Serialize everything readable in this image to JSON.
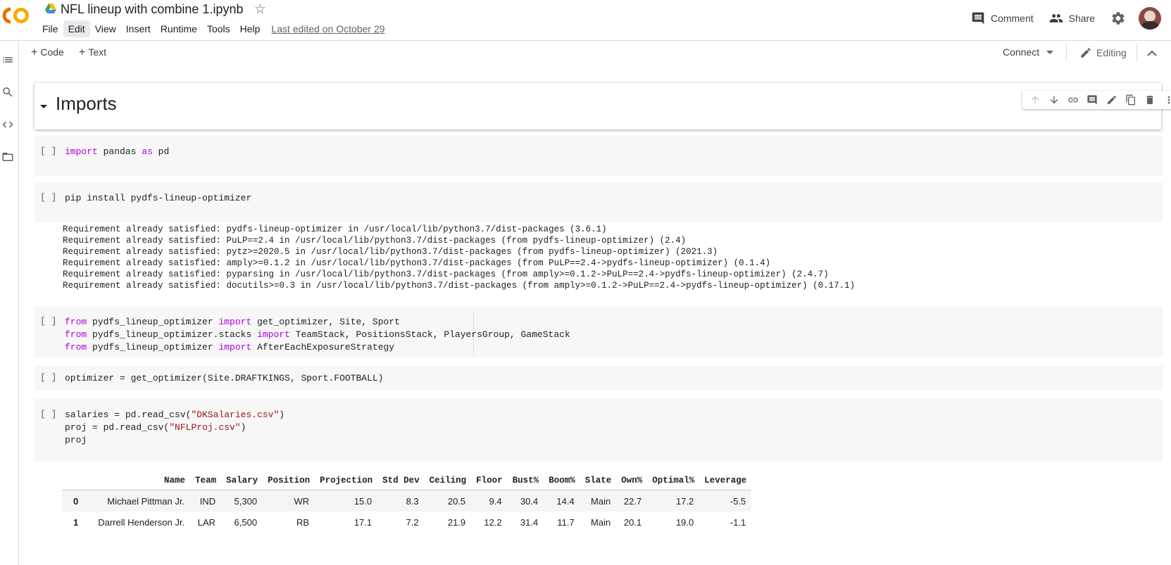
{
  "app": {
    "title": "NFL lineup with combine 1.ipynb",
    "menu": [
      "File",
      "Edit",
      "View",
      "Insert",
      "Runtime",
      "Tools",
      "Help"
    ],
    "active_menu": "Edit",
    "last_edited": "Last edited on October 29",
    "comment_label": "Comment",
    "share_label": "Share"
  },
  "toolbar": {
    "code_label": "Code",
    "text_label": "Text",
    "connect_label": "Connect",
    "editing_label": "Editing"
  },
  "cells": {
    "heading": "Imports",
    "run_bracket": "[ ]",
    "c1": [
      "import pandas as pd"
    ],
    "c2": [
      "pip install pydfs-lineup-optimizer"
    ],
    "c2_output": [
      "Requirement already satisfied: pydfs-lineup-optimizer in /usr/local/lib/python3.7/dist-packages (3.6.1)",
      "Requirement already satisfied: PuLP==2.4 in /usr/local/lib/python3.7/dist-packages (from pydfs-lineup-optimizer) (2.4)",
      "Requirement already satisfied: pytz>=2020.5 in /usr/local/lib/python3.7/dist-packages (from pydfs-lineup-optimizer) (2021.3)",
      "Requirement already satisfied: amply>=0.1.2 in /usr/local/lib/python3.7/dist-packages (from PuLP==2.4->pydfs-lineup-optimizer) (0.1.4)",
      "Requirement already satisfied: pyparsing in /usr/local/lib/python3.7/dist-packages (from amply>=0.1.2->PuLP==2.4->pydfs-lineup-optimizer) (2.4.7)",
      "Requirement already satisfied: docutils>=0.3 in /usr/local/lib/python3.7/dist-packages (from amply>=0.1.2->PuLP==2.4->pydfs-lineup-optimizer) (0.17.1)"
    ],
    "c3": [
      "from pydfs_lineup_optimizer import get_optimizer, Site, Sport",
      "from pydfs_lineup_optimizer.stacks import TeamStack, PositionsStack, PlayersGroup, GameStack",
      "from pydfs_lineup_optimizer import AfterEachExposureStrategy"
    ],
    "c4": [
      "optimizer = get_optimizer(Site.DRAFTKINGS, Sport.FOOTBALL)"
    ],
    "c5": [
      "salaries = pd.read_csv(\"DKSalaries.csv\")",
      "proj = pd.read_csv(\"NFLProj.csv\")",
      "proj"
    ]
  },
  "table": {
    "columns": [
      "Name",
      "Team",
      "Salary",
      "Position",
      "Projection",
      "Std Dev",
      "Ceiling",
      "Floor",
      "Bust%",
      "Boom%",
      "Slate",
      "Own%",
      "Optimal%",
      "Leverage"
    ],
    "rows": [
      {
        "index": "0",
        "values": [
          "Michael Pittman Jr.",
          "IND",
          "5,300",
          "WR",
          "15.0",
          "8.3",
          "20.5",
          "9.4",
          "30.4",
          "14.4",
          "Main",
          "22.7",
          "17.2",
          "-5.5"
        ]
      },
      {
        "index": "1",
        "values": [
          "Darrell Henderson Jr.",
          "LAR",
          "6,500",
          "RB",
          "17.1",
          "7.2",
          "21.9",
          "12.2",
          "31.4",
          "11.7",
          "Main",
          "20.1",
          "19.0",
          "-1.1"
        ]
      }
    ]
  },
  "icons": {
    "logo": "colab-logo-icon",
    "drive": "google-drive-icon",
    "star": "star-icon",
    "comment": "comment-icon",
    "share": "share-people-icon",
    "settings": "gear-icon",
    "toc": "table-of-contents-icon",
    "search": "search-icon",
    "code_snippets": "code-icon",
    "files": "folder-icon",
    "editing": "pencil-icon"
  },
  "colors": {
    "keyword": "#af00db",
    "string": "#a31515",
    "cell_bg": "#f7f7f7",
    "logo_orange": "#f9ab00",
    "logo_dark_orange": "#e8710a"
  }
}
